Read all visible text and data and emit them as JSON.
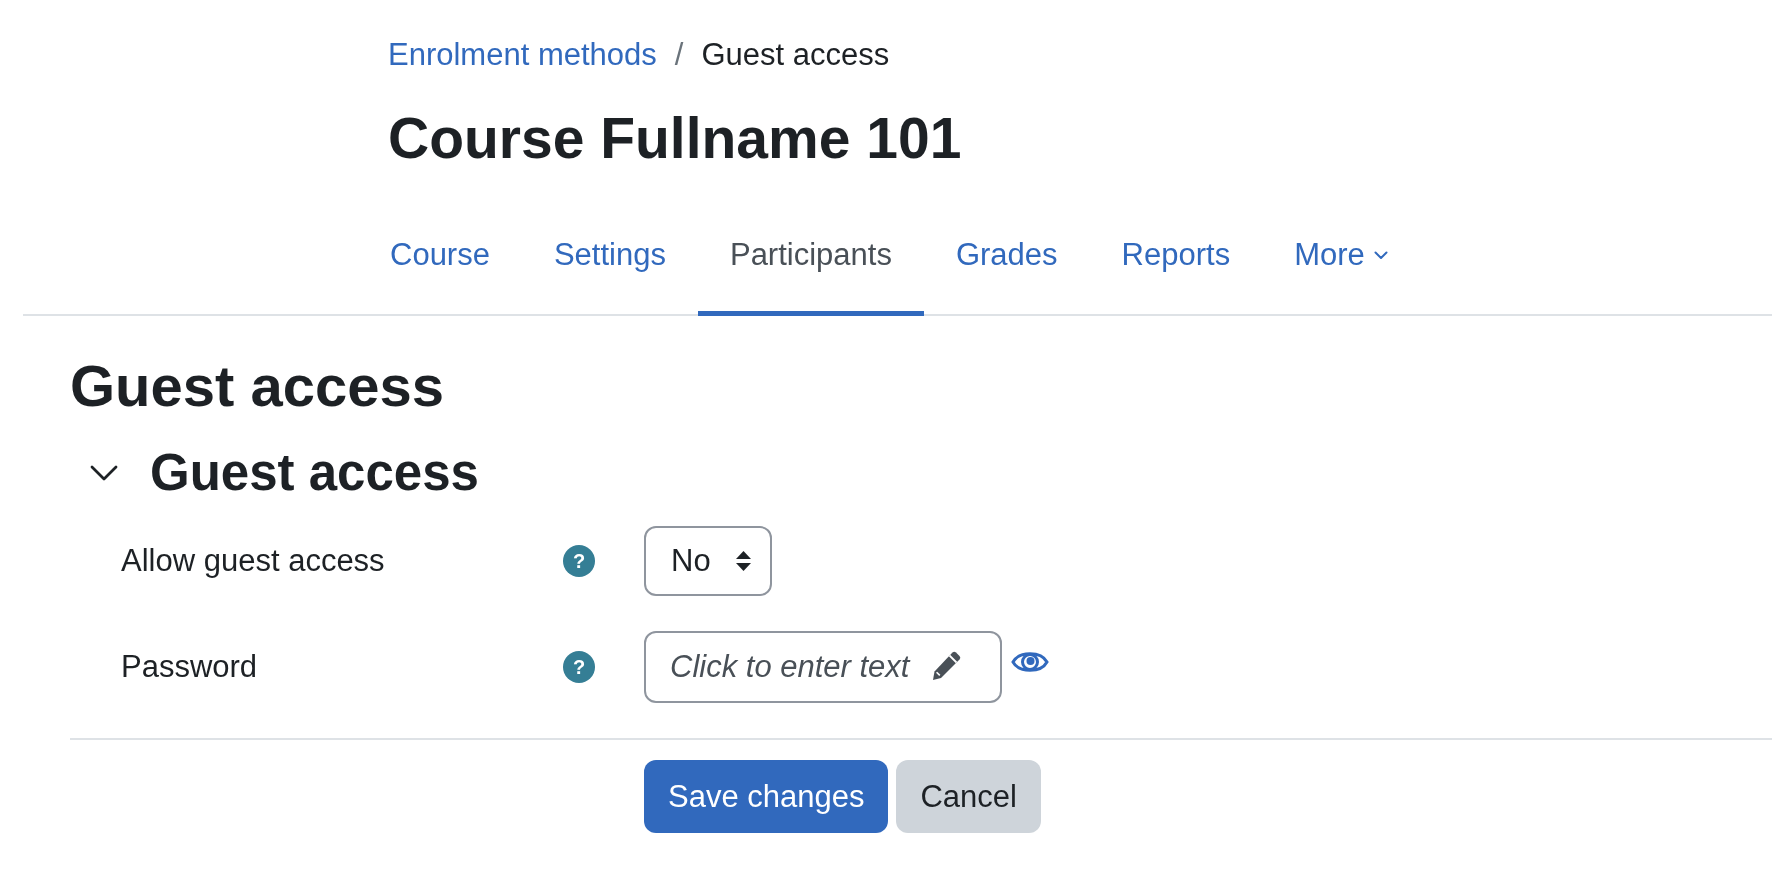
{
  "breadcrumb": {
    "separator": "/",
    "items": [
      {
        "label": "Enrolment methods",
        "current": false
      },
      {
        "label": "Guest access",
        "current": true
      }
    ]
  },
  "course_title": "Course Fullname 101",
  "tabs": [
    {
      "label": "Course",
      "selected": false,
      "dropdown": false
    },
    {
      "label": "Settings",
      "selected": false,
      "dropdown": false
    },
    {
      "label": "Participants",
      "selected": true,
      "dropdown": false
    },
    {
      "label": "Grades",
      "selected": false,
      "dropdown": false
    },
    {
      "label": "Reports",
      "selected": false,
      "dropdown": false
    },
    {
      "label": "More",
      "selected": false,
      "dropdown": true
    }
  ],
  "page_heading": "Guest access",
  "section": {
    "title": "Guest access",
    "expanded": true,
    "fields": [
      {
        "kind": "select",
        "label": "Allow guest access",
        "help": "?",
        "value": "No"
      },
      {
        "kind": "password",
        "label": "Password",
        "help": "?",
        "placeholder": "Click to enter text"
      }
    ]
  },
  "buttons": [
    {
      "label": "Save changes",
      "kind": "primary"
    },
    {
      "label": "Cancel",
      "kind": "secondary"
    }
  ]
}
